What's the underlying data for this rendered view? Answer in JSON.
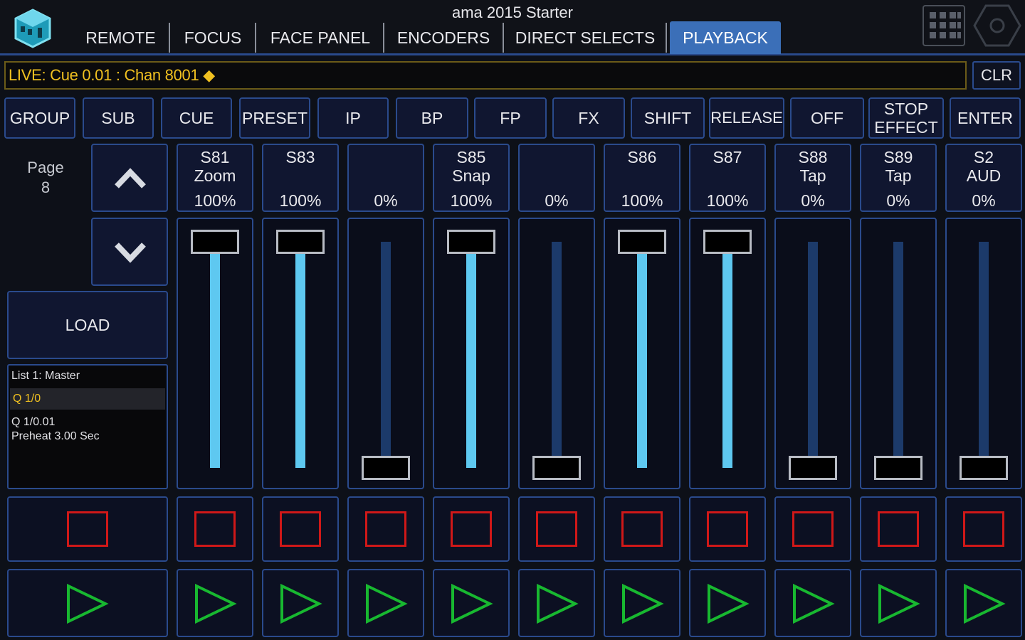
{
  "header": {
    "title": "ama 2015 Starter",
    "tabs": [
      {
        "label": "REMOTE",
        "active": false
      },
      {
        "label": "FOCUS",
        "active": false
      },
      {
        "label": "FACE PANEL",
        "active": false
      },
      {
        "label": "ENCODERS",
        "active": false
      },
      {
        "label": "DIRECT SELECTS",
        "active": false
      },
      {
        "label": "PLAYBACK",
        "active": true
      }
    ],
    "icons": [
      "cube-logo-icon",
      "keypad-grid-icon",
      "settings-hex-icon"
    ]
  },
  "command_line": {
    "text": "LIVE: Cue  0.01 : Chan 8001 ◆",
    "clear_label": "CLR"
  },
  "softkeys": [
    "GROUP",
    "SUB",
    "CUE",
    "PRESET",
    "IP",
    "BP",
    "FP",
    "FX",
    "SHIFT",
    "RELEASE",
    "OFF",
    "STOP\nEFFECT",
    "ENTER"
  ],
  "page": {
    "label": "Page",
    "number": "8"
  },
  "load_label": "LOAD",
  "cuelist": {
    "title": "List 1: Master",
    "active": "Q 1/0",
    "next_line1": "Q 1/0.01",
    "next_line2": "Preheat 3.00 Sec"
  },
  "faders": [
    {
      "name_line1": "S81",
      "name_line2": "Zoom",
      "value": "100%",
      "level": 1.0
    },
    {
      "name_line1": "S83",
      "name_line2": "",
      "value": "100%",
      "level": 1.0
    },
    {
      "name_line1": "",
      "name_line2": "",
      "value": "0%",
      "level": 0.0
    },
    {
      "name_line1": "S85",
      "name_line2": "Snap",
      "value": "100%",
      "level": 1.0
    },
    {
      "name_line1": "",
      "name_line2": "",
      "value": "0%",
      "level": 0.0
    },
    {
      "name_line1": "S86",
      "name_line2": "",
      "value": "100%",
      "level": 1.0
    },
    {
      "name_line1": "S87",
      "name_line2": "",
      "value": "100%",
      "level": 1.0
    },
    {
      "name_line1": "S88",
      "name_line2": "Tap",
      "value": "0%",
      "level": 0.0
    },
    {
      "name_line1": "S89",
      "name_line2": "Tap",
      "value": "0%",
      "level": 0.0
    },
    {
      "name_line1": "S2",
      "name_line2": "AUD",
      "value": "0%",
      "level": 0.0
    }
  ],
  "colors": {
    "accent": "#3b6fb8",
    "border": "#2a4a8c",
    "command_text": "#f0c020",
    "fader_fill": "#5ec8f0",
    "stop": "#d01818",
    "go": "#18b830"
  }
}
